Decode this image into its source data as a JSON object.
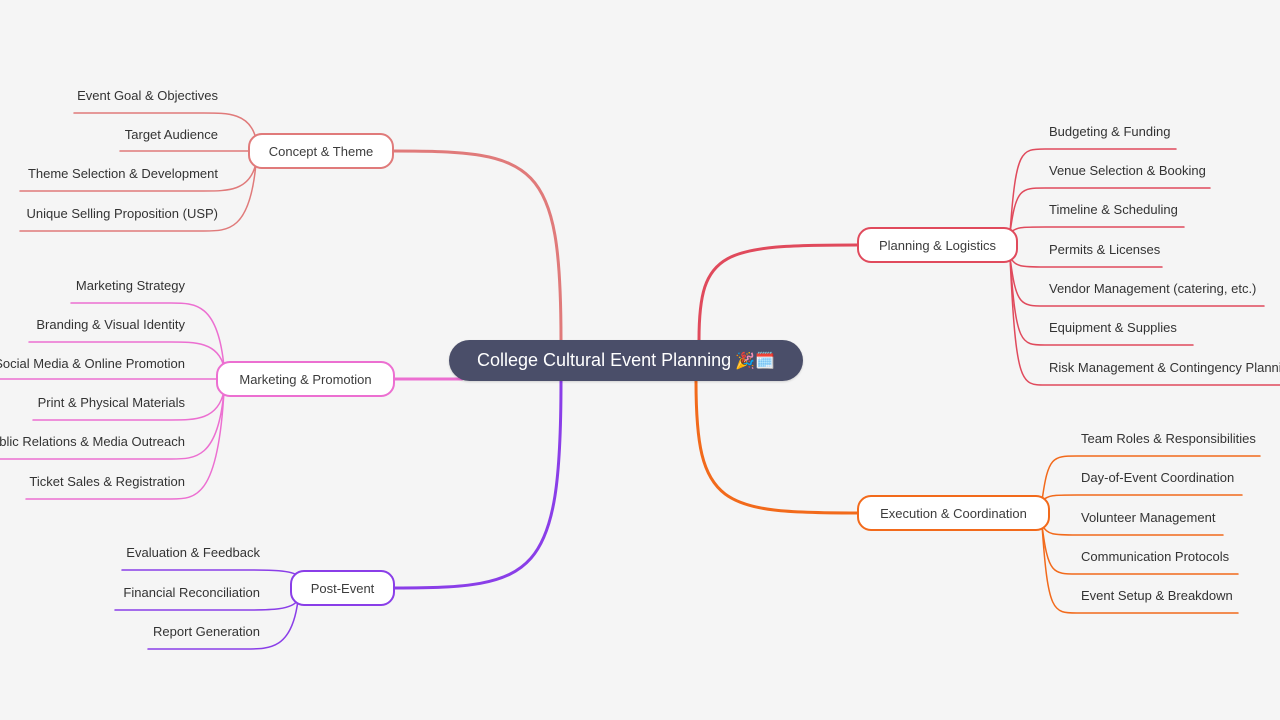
{
  "mindmap": {
    "root": {
      "label": "College Cultural Event Planning",
      "emoji": "🎉🗓️",
      "background": "#4a4e69",
      "text_color": "#ffffff"
    },
    "branches": [
      {
        "id": "concept",
        "label": "Concept & Theme",
        "side": "left",
        "color": "#e07a7a",
        "children": [
          "Event Goal & Objectives",
          "Target Audience",
          "Theme Selection & Development",
          "Unique Selling Proposition (USP)"
        ]
      },
      {
        "id": "marketing",
        "label": "Marketing & Promotion",
        "side": "left",
        "color": "#ec6fd1",
        "children": [
          "Marketing Strategy",
          "Branding & Visual Identity",
          "Social Media & Online Promotion",
          "Print & Physical Materials",
          "Public Relations & Media Outreach",
          "Ticket Sales & Registration"
        ]
      },
      {
        "id": "post-event",
        "label": "Post-Event",
        "side": "left",
        "color": "#8a3ee8",
        "children": [
          "Evaluation & Feedback",
          "Financial Reconciliation",
          "Report Generation"
        ]
      },
      {
        "id": "planning",
        "label": "Planning & Logistics",
        "side": "right",
        "color": "#e04a5c",
        "children": [
          "Budgeting & Funding",
          "Venue Selection & Booking",
          "Timeline & Scheduling",
          "Permits & Licenses",
          "Vendor Management (catering, etc.)",
          "Equipment & Supplies",
          "Risk Management & Contingency Planning"
        ]
      },
      {
        "id": "execution",
        "label": "Execution & Coordination",
        "side": "right",
        "color": "#f26a1b",
        "children": [
          "Team Roles & Responsibilities",
          "Day-of-Event Coordination",
          "Volunteer Management",
          "Communication Protocols",
          "Event Setup & Breakdown"
        ]
      }
    ]
  }
}
